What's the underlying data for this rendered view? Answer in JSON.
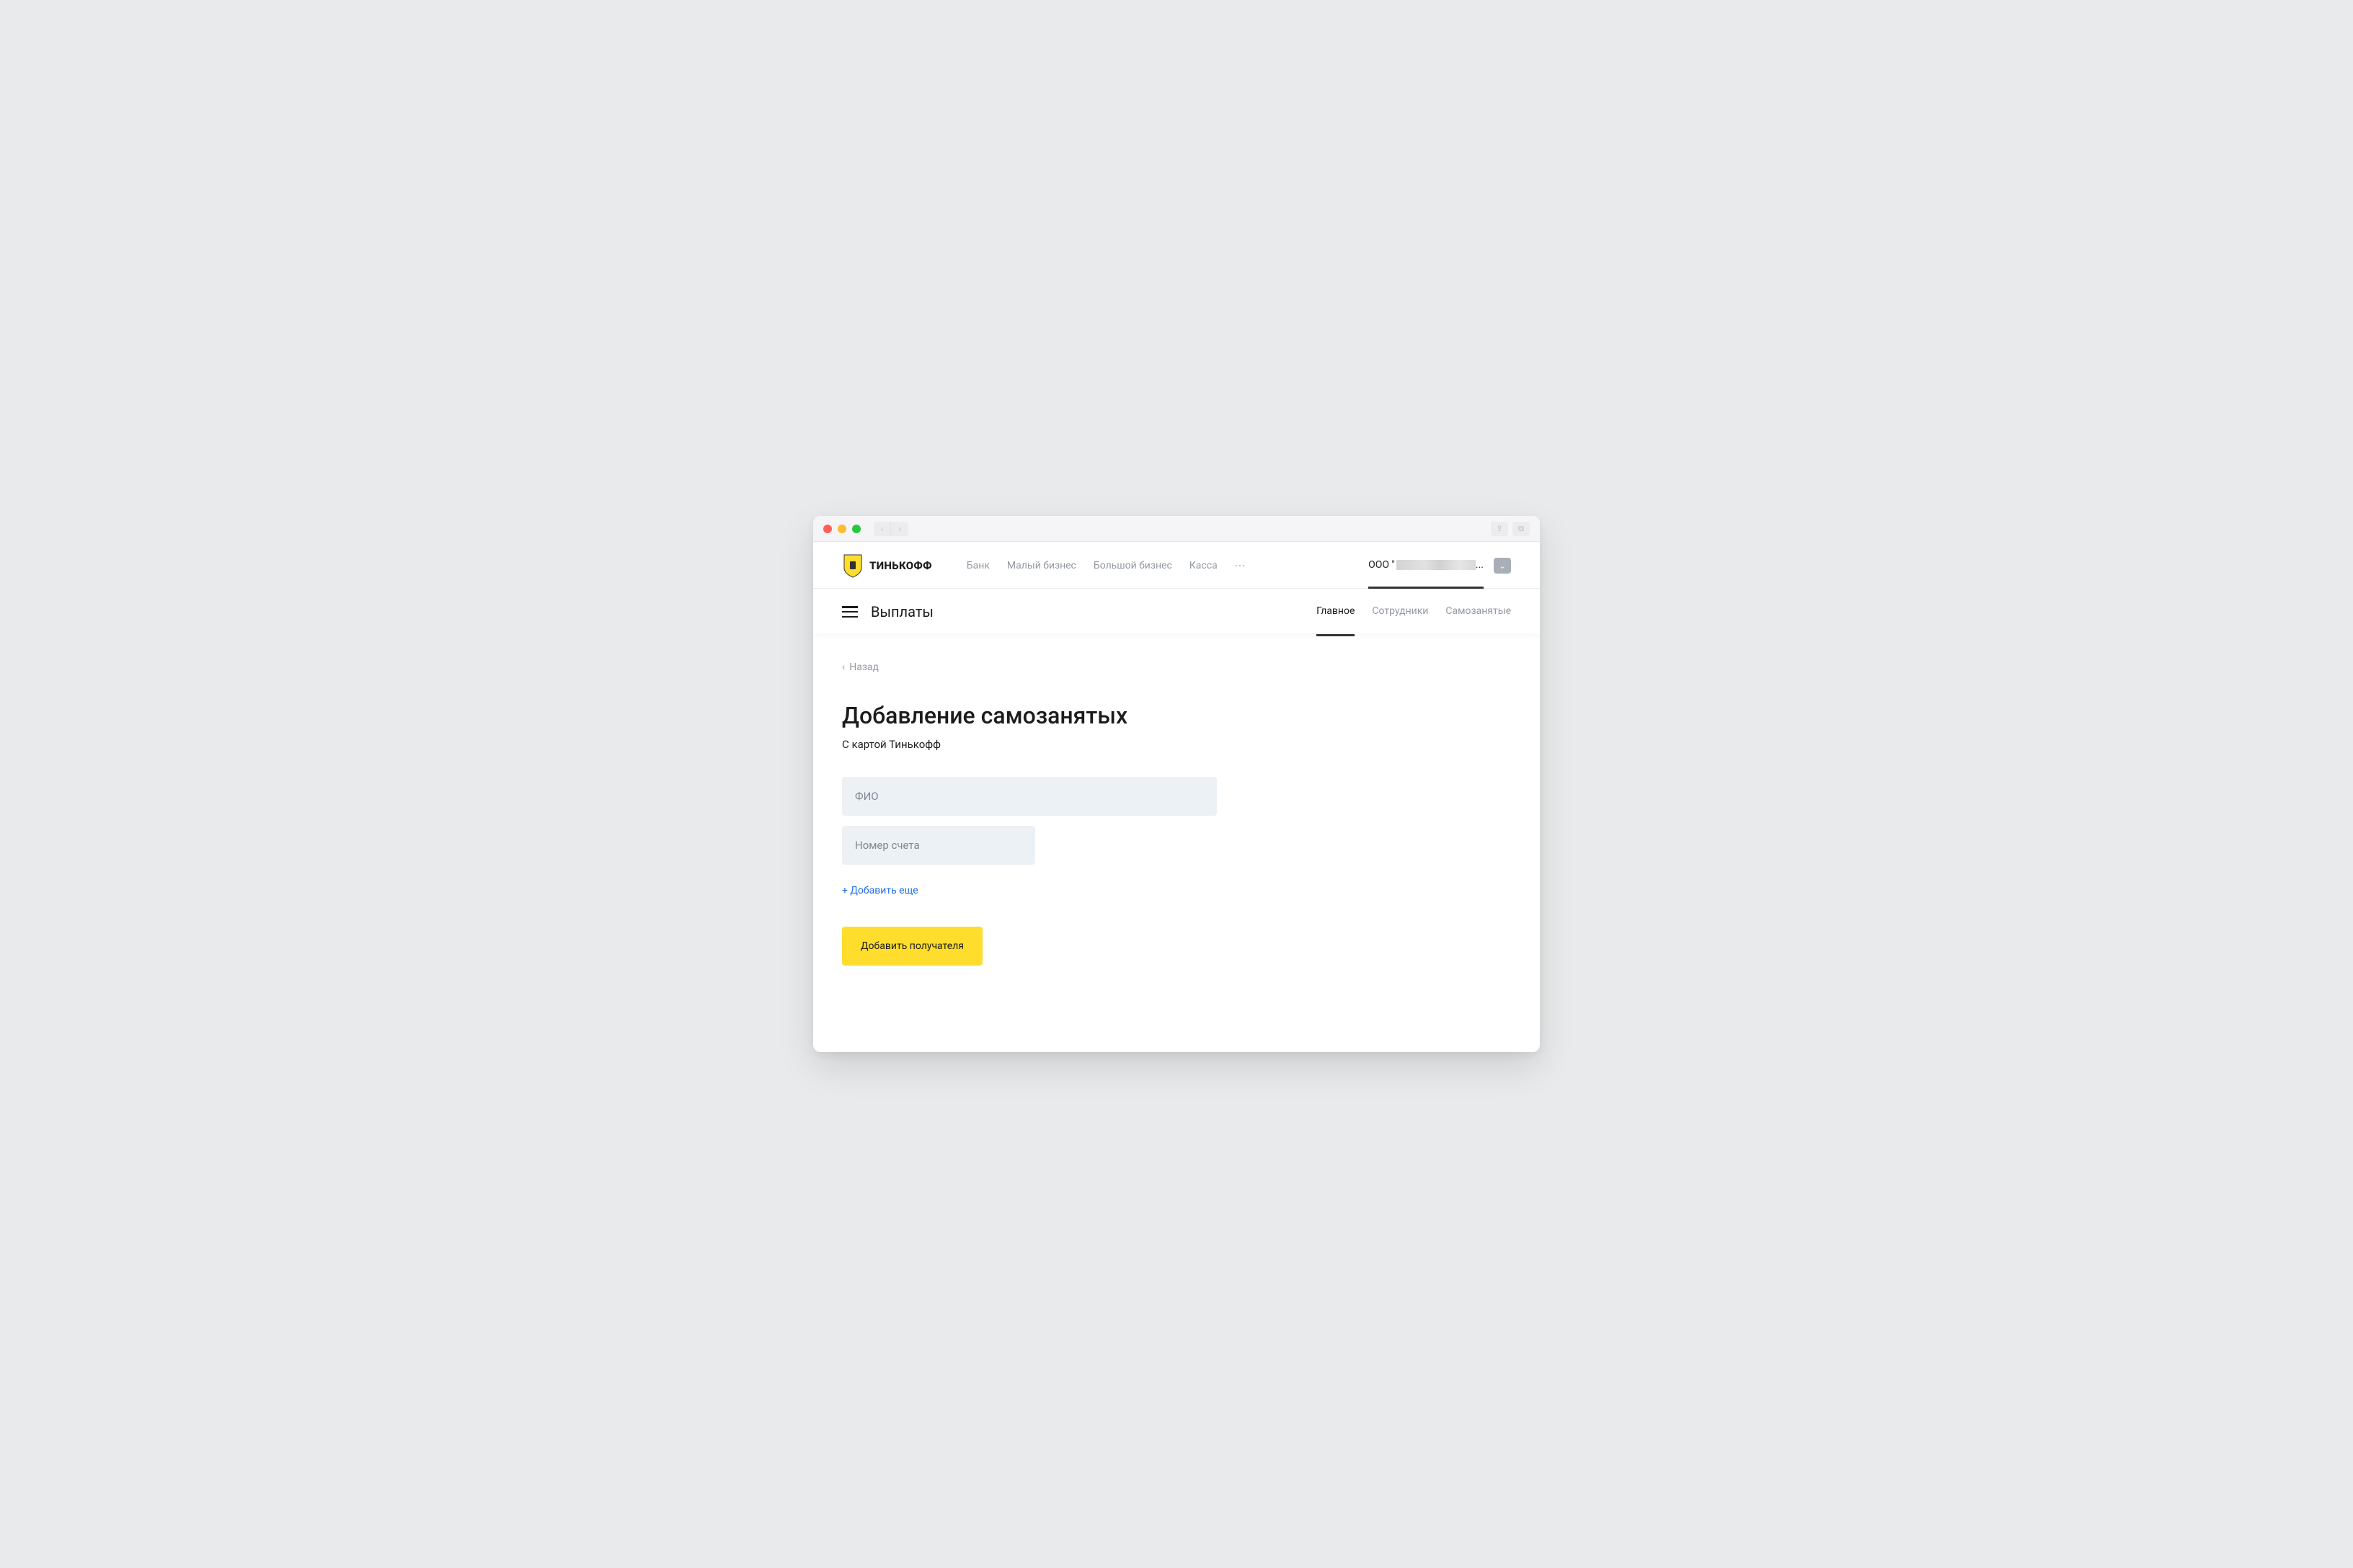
{
  "browser": {
    "share_icon": "⇪",
    "tabs_icon": "⧉"
  },
  "header": {
    "logo_text": "ТИНЬКОФФ",
    "nav": [
      "Банк",
      "Малый бизнес",
      "Большой бизнес",
      "Касса"
    ],
    "more": "···",
    "company_prefix": "ООО \"",
    "company_suffix": "...",
    "dropdown_chevron": "⌄"
  },
  "subheader": {
    "section": "Выплаты",
    "tabs": [
      "Главное",
      "Сотрудники",
      "Самозанятые"
    ],
    "active_tab": 0
  },
  "back": {
    "chevron": "‹",
    "label": "Назад"
  },
  "page": {
    "title": "Добавление самозанятых",
    "subtitle": "С картой Тинькофф"
  },
  "form": {
    "fio_placeholder": "ФИО",
    "account_placeholder": "Номер счета",
    "add_more": "+ Добавить еще",
    "submit": "Добавить получателя"
  }
}
